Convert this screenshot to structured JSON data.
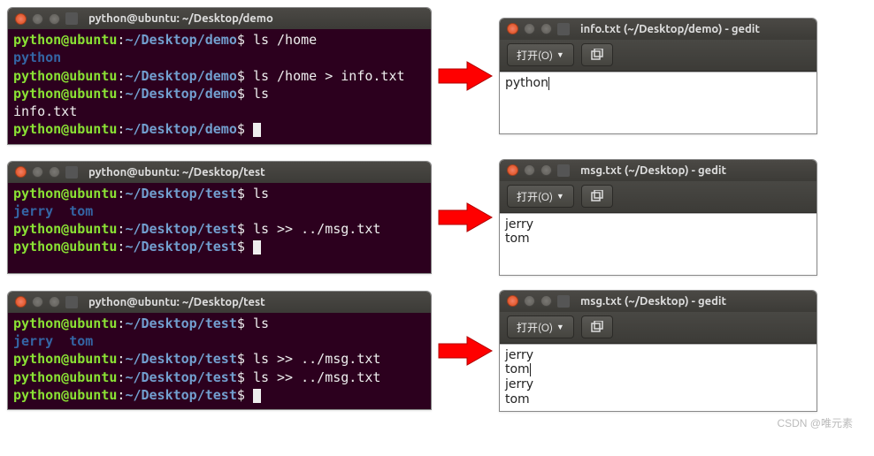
{
  "watermark": "CSDN @唯元素",
  "rows": [
    {
      "term_title": "python@ubuntu: ~/Desktop/demo",
      "prompt_user": "python@ubuntu",
      "prompt_sep1": ":",
      "prompt_path": "~/Desktop/demo",
      "prompt_sep2": "$",
      "lines": [
        {
          "type": "cmd",
          "cmd": "ls /home"
        },
        {
          "type": "out",
          "text": "python",
          "style": "blue"
        },
        {
          "type": "cmd",
          "cmd": "ls /home > info.txt"
        },
        {
          "type": "cmd",
          "cmd": "ls"
        },
        {
          "type": "out",
          "text": "info.txt",
          "style": "plain"
        },
        {
          "type": "cmd",
          "cmd": "",
          "cursor": true
        }
      ],
      "gedit_title": "info.txt (~/Desktop/demo) - gedit",
      "gedit_open": "打开(O)",
      "gedit_content": "python",
      "caret_after": true
    },
    {
      "term_title": "python@ubuntu: ~/Desktop/test",
      "prompt_user": "python@ubuntu",
      "prompt_sep1": ":",
      "prompt_path": "~/Desktop/test",
      "prompt_sep2": "$",
      "lines": [
        {
          "type": "cmd",
          "cmd": "ls"
        },
        {
          "type": "out",
          "text": "jerry  tom",
          "style": "blue"
        },
        {
          "type": "cmd",
          "cmd": "ls >> ../msg.txt"
        },
        {
          "type": "cmd",
          "cmd": "",
          "cursor": true
        }
      ],
      "gedit_title": "msg.txt (~/Desktop) - gedit",
      "gedit_open": "打开(O)",
      "gedit_content": "jerry\ntom",
      "caret_after": false
    },
    {
      "term_title": "python@ubuntu: ~/Desktop/test",
      "prompt_user": "python@ubuntu",
      "prompt_sep1": ":",
      "prompt_path": "~/Desktop/test",
      "prompt_sep2": "$",
      "lines": [
        {
          "type": "cmd",
          "cmd": "ls"
        },
        {
          "type": "out",
          "text": "jerry  tom",
          "style": "blue"
        },
        {
          "type": "cmd",
          "cmd": "ls >> ../msg.txt"
        },
        {
          "type": "cmd",
          "cmd": "ls >> ../msg.txt"
        },
        {
          "type": "cmd",
          "cmd": "",
          "cursor": true
        }
      ],
      "gedit_title": "msg.txt (~/Desktop) - gedit",
      "gedit_open": "打开(O)",
      "gedit_content": "jerry\ntom\njerry\ntom",
      "caret_after": false,
      "caret_mid": 1
    }
  ]
}
